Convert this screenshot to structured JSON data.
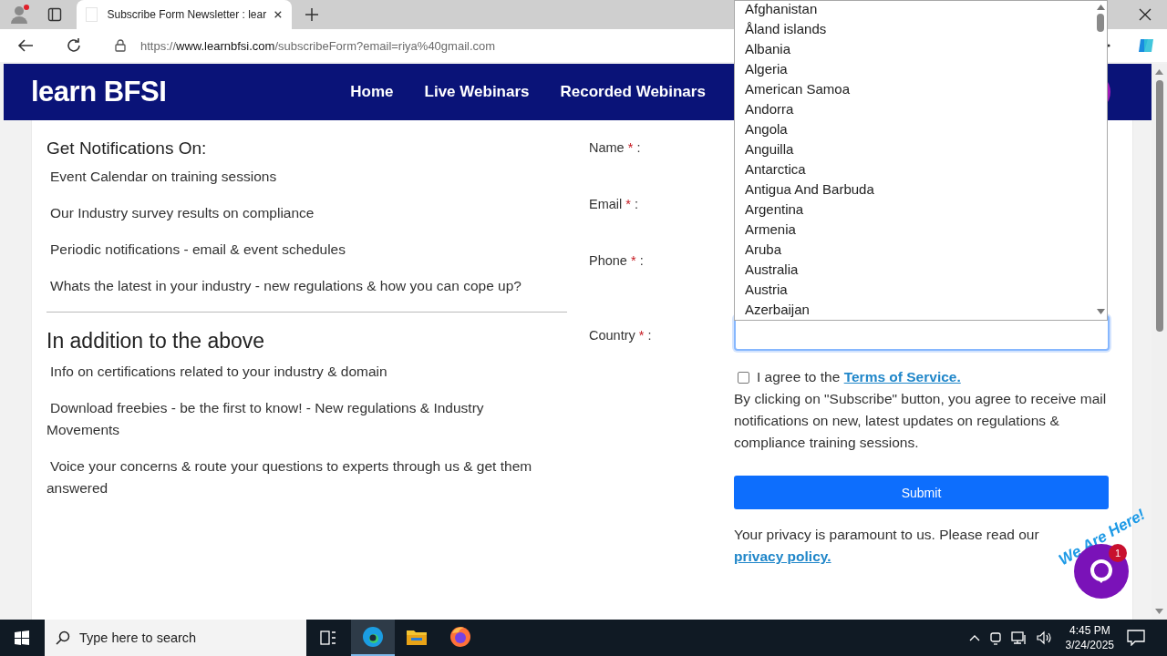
{
  "browser": {
    "tabs": [
      {
        "title": "Subscribe Form Newsletter : lear",
        "selected": true
      }
    ],
    "url": {
      "scheme": "https://",
      "domain": "www.learnbfsi.com",
      "path": "/subscribeForm?email=riya%40gmail.com"
    }
  },
  "site": {
    "logo": "learn BFSI",
    "nav": [
      {
        "label": "Home"
      },
      {
        "label": "Live Webinars"
      },
      {
        "label": "Recorded Webinars"
      }
    ]
  },
  "benefits": [
    {
      "heading": "Get Notifications On:",
      "items": [
        "Event Calendar on training sessions",
        "Our Industry survey results on compliance",
        "Periodic notifications - email & event schedules",
        "Whats the latest in your industry - new regulations & how you can cope up?"
      ]
    },
    {
      "heading": "In addition to the above",
      "items": [
        "Info on certifications related to your industry & domain",
        "Download freebies - be the first to know! - New regulations & Industry Movements",
        "Voice your concerns & route your questions to experts through us & get them answered"
      ]
    }
  ],
  "form": {
    "fields": [
      {
        "label": "Name",
        "mark": "*",
        "colon": ":",
        "kind": "hidden"
      },
      {
        "label": "Email",
        "mark": "*",
        "colon": ":",
        "kind": "hidden"
      },
      {
        "label": "Phone",
        "mark": "*",
        "colon": ":",
        "kind": "hidden"
      },
      {
        "label": "Country",
        "mark": "*",
        "colon": ":",
        "kind": "select",
        "focused": true
      }
    ],
    "country_options": [
      "Afghanistan",
      "Åland islands",
      "Albania",
      "Algeria",
      "American Samoa",
      "Andorra",
      "Angola",
      "Anguilla",
      "Antarctica",
      "Antigua And Barbuda",
      "Argentina",
      "Armenia",
      "Aruba",
      "Australia",
      "Austria",
      "Azerbaijan"
    ],
    "agree": {
      "checked": false,
      "text": "I agree to the",
      "link": "Terms of Service."
    },
    "notice": "By clicking on \"Subscribe\" button, you agree to receive mail notifications on new, latest updates on regulations & compliance training sessions.",
    "submit": "Submit",
    "privacy": {
      "text": "Your privacy is paramount to us. Please read our",
      "link": "privacy policy."
    }
  },
  "chat": {
    "tagline": "We Are Here!",
    "badge": "1"
  },
  "taskbar": {
    "search_placeholder": "Type here to search",
    "time": "4:45 PM",
    "date": "3/24/2025"
  }
}
